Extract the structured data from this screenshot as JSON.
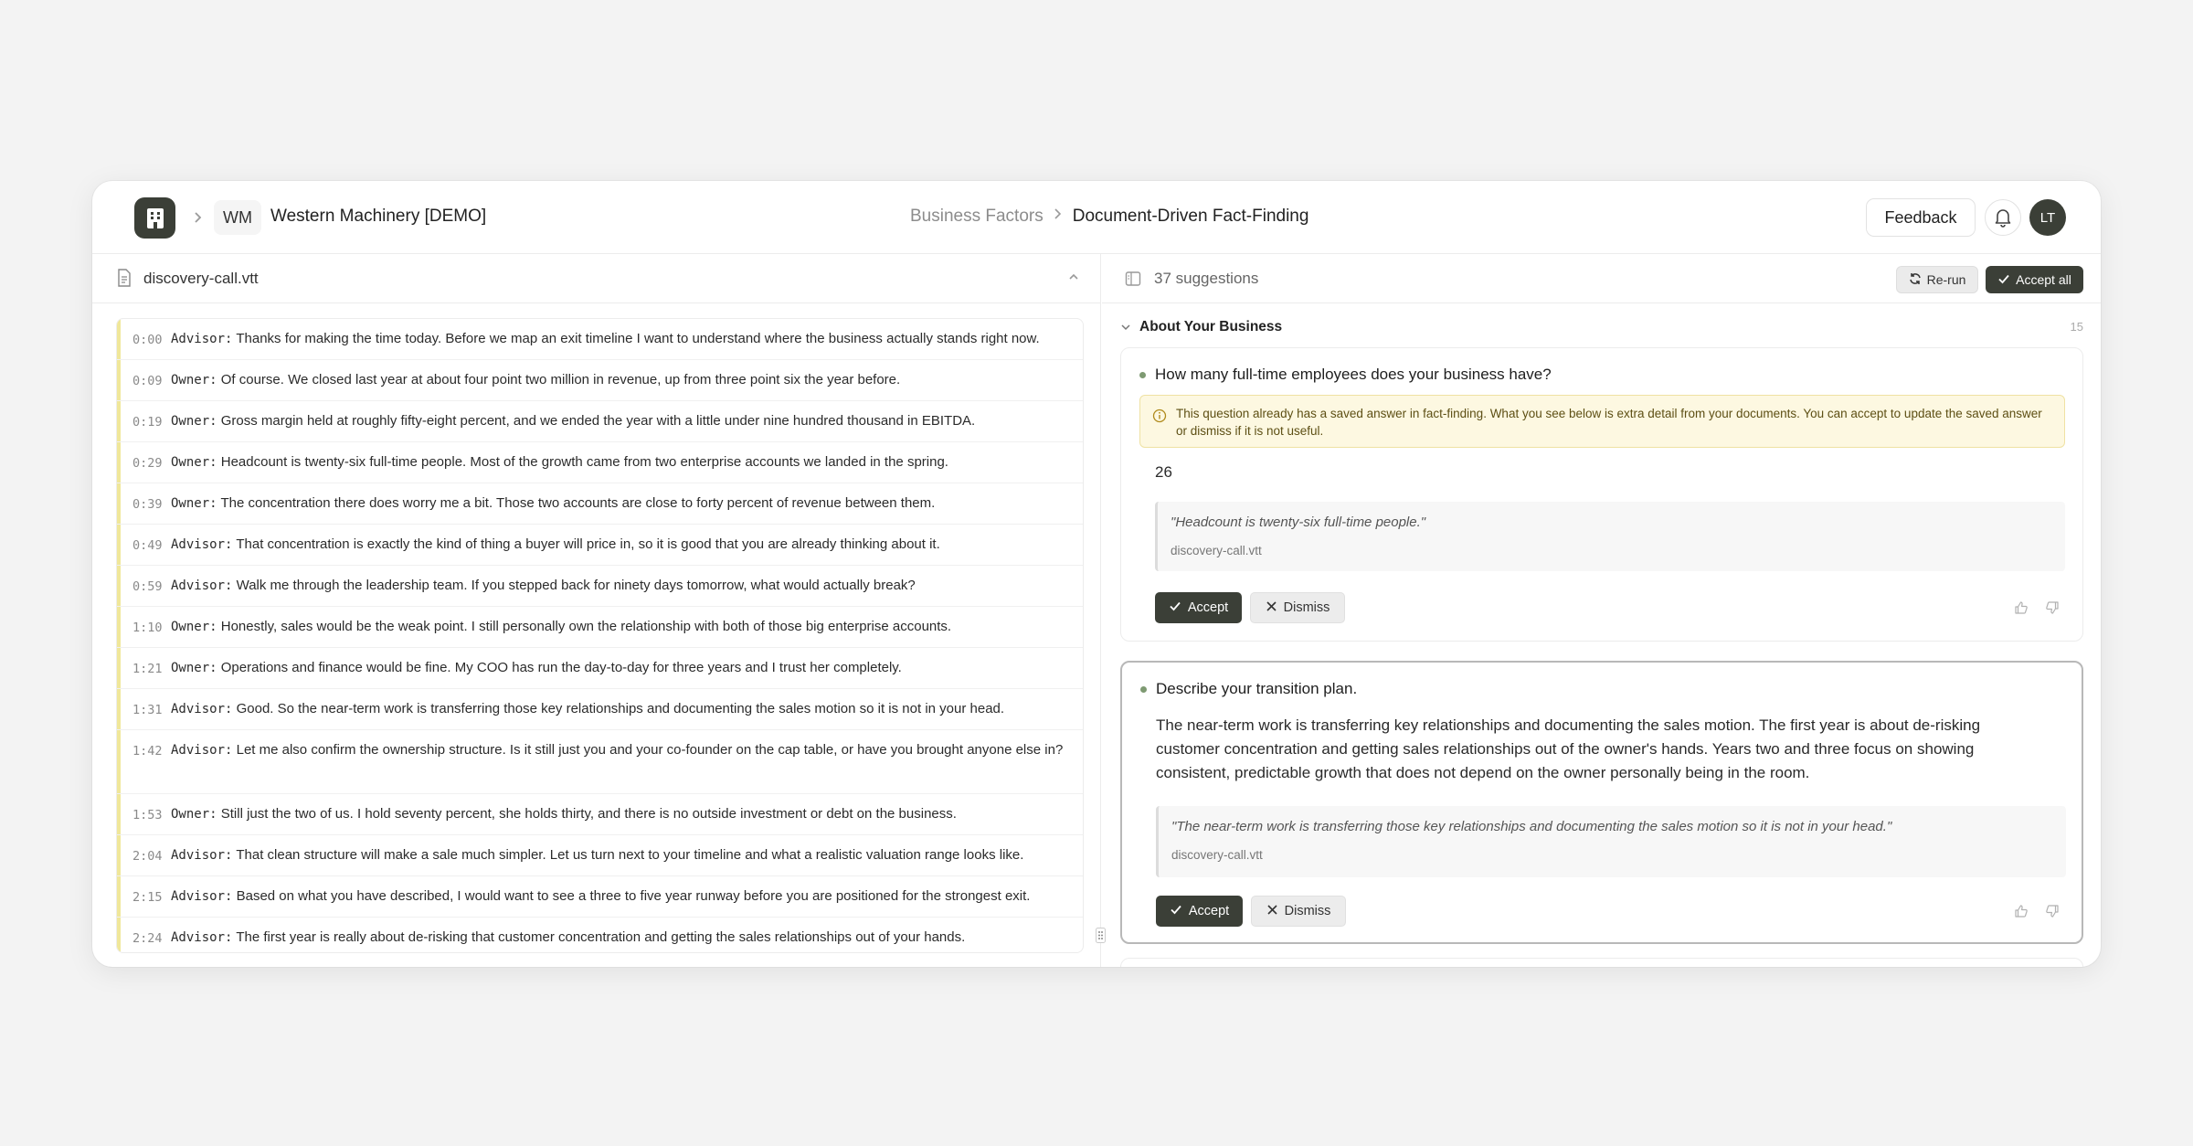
{
  "topbar": {
    "workspace_initials": "WM",
    "workspace_name": "Western Machinery [DEMO]",
    "breadcrumb_parent": "Business Factors",
    "breadcrumb_current": "Document-Driven Fact-Finding",
    "feedback_label": "Feedback",
    "avatar_initials": "LT"
  },
  "transcript": {
    "file_name": "discovery-call.vtt",
    "rows": [
      {
        "time": "0:00",
        "speaker": "Advisor:",
        "text": "Thanks for making the time today. Before we map an exit timeline I want to understand where the business actually stands right now."
      },
      {
        "time": "0:09",
        "speaker": "Owner:",
        "text": "Of course. We closed last year at about four point two million in revenue, up from three point six the year before."
      },
      {
        "time": "0:19",
        "speaker": "Owner:",
        "text": "Gross margin held at roughly fifty-eight percent, and we ended the year with a little under nine hundred thousand in EBITDA."
      },
      {
        "time": "0:29",
        "speaker": "Owner:",
        "text": "Headcount is twenty-six full-time people. Most of the growth came from two enterprise accounts we landed in the spring."
      },
      {
        "time": "0:39",
        "speaker": "Owner:",
        "text": "The concentration there does worry me a bit. Those two accounts are close to forty percent of revenue between them."
      },
      {
        "time": "0:49",
        "speaker": "Advisor:",
        "text": "That concentration is exactly the kind of thing a buyer will price in, so it is good that you are already thinking about it."
      },
      {
        "time": "0:59",
        "speaker": "Advisor:",
        "text": "Walk me through the leadership team. If you stepped back for ninety days tomorrow, what would actually break?"
      },
      {
        "time": "1:10",
        "speaker": "Owner:",
        "text": "Honestly, sales would be the weak point. I still personally own the relationship with both of those big enterprise accounts."
      },
      {
        "time": "1:21",
        "speaker": "Owner:",
        "text": "Operations and finance would be fine. My COO has run the day-to-day for three years and I trust her completely."
      },
      {
        "time": "1:31",
        "speaker": "Advisor:",
        "text": "Good. So the near-term work is transferring those key relationships and documenting the sales motion so it is not in your head."
      },
      {
        "time": "1:42",
        "speaker": "Advisor:",
        "text": "Let me also confirm the ownership structure. Is it still just you and your co-founder on the cap table, or have you brought anyone else in?"
      },
      {
        "time": "1:53",
        "speaker": "Owner:",
        "text": "Still just the two of us. I hold seventy percent, she holds thirty, and there is no outside investment or debt on the business."
      },
      {
        "time": "2:04",
        "speaker": "Advisor:",
        "text": "That clean structure will make a sale much simpler. Let us turn next to your timeline and what a realistic valuation range looks like."
      },
      {
        "time": "2:15",
        "speaker": "Advisor:",
        "text": "Based on what you have described, I would want to see a three to five year runway before you are positioned for the strongest exit."
      },
      {
        "time": "2:24",
        "speaker": "Advisor:",
        "text": "The first year is really about de-risking that customer concentration and getting the sales relationships out of your hands."
      }
    ]
  },
  "suggestions": {
    "count_label": "37 suggestions",
    "rerun_label": "Re-run",
    "accept_all_label": "Accept all",
    "section_title": "About Your Business",
    "section_count": "15",
    "cards": [
      {
        "question": "How many full-time employees does your business have?",
        "warning": "This question already has a saved answer in fact-finding. What you see below is extra detail from your documents. You can accept to update the saved answer or dismiss if it is not useful.",
        "answer": "26",
        "quote": "\"Headcount is twenty-six full-time people.\"",
        "source": "discovery-call.vtt",
        "accept_label": "Accept",
        "dismiss_label": "Dismiss"
      },
      {
        "question": "Describe your transition plan.",
        "answer": "The near-term work is transferring key relationships and documenting the sales motion. The first year is about de-risking customer concentration and getting sales relationships out of the owner's hands. Years two and three focus on showing consistent, predictable growth that does not depend on the owner personally being in the room.",
        "quote": "\"The near-term work is transferring those key relationships and documenting the sales motion so it is not in your head.\"",
        "source": "discovery-call.vtt",
        "accept_label": "Accept",
        "dismiss_label": "Dismiss"
      }
    ]
  },
  "icons": {
    "logo": "building-icon",
    "breadcrumb_separator": "chevron-right-icon",
    "bell": "bell-icon",
    "file": "file-icon",
    "collapse": "chevron-up-icon",
    "panel": "panel-icon",
    "rerun": "refresh-icon",
    "check": "check-icon",
    "close": "x-icon",
    "info": "info-icon",
    "thumbs_up": "thumbs-up-icon",
    "thumbs_down": "thumbs-down-icon"
  },
  "colors": {
    "primary": "#3b3f37",
    "warning_bg": "#fdf8e1",
    "highlight_bar": "#f0e79a",
    "bullet": "#7e9a72"
  }
}
